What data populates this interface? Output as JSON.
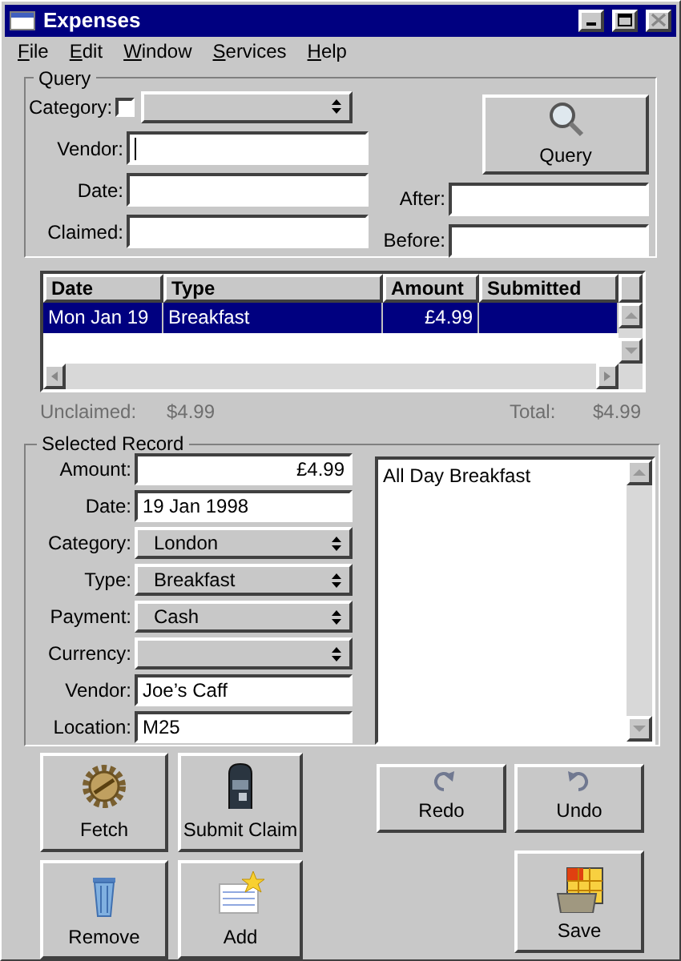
{
  "window": {
    "title": "Expenses"
  },
  "menu": [
    {
      "label": "File"
    },
    {
      "label": "Edit"
    },
    {
      "label": "Window"
    },
    {
      "label": "Services"
    },
    {
      "label": "Help"
    }
  ],
  "query": {
    "title": "Query",
    "category": {
      "label": "Category:",
      "checked": false
    },
    "fields": [
      {
        "label": "Vendor:",
        "focused": true
      },
      {
        "label": "Date:",
        "focused": false
      },
      {
        "label": "Claimed:",
        "focused": false
      }
    ],
    "range": [
      {
        "label": "After:"
      },
      {
        "label": "Before:"
      }
    ],
    "button": "Query"
  },
  "table": {
    "columns": [
      "Date",
      "Type",
      "Amount",
      "Submitted"
    ],
    "rows": [
      {
        "cells": [
          "Mon Jan 19",
          "Breakfast",
          "£4.99",
          ""
        ],
        "selected": true
      }
    ]
  },
  "totals": [
    {
      "label": "Unclaimed:",
      "value": "$4.99"
    },
    {
      "label": "Total:",
      "value": "$4.99"
    }
  ],
  "record": {
    "title": "Selected Record",
    "fields": [
      {
        "kind": "number",
        "label": "Amount:",
        "value": "£4.99"
      },
      {
        "kind": "text",
        "label": "Date:",
        "value": "19 Jan 1998"
      },
      {
        "kind": "select",
        "label": "Category:",
        "value": "London"
      },
      {
        "kind": "select",
        "label": "Type:",
        "value": "Breakfast"
      },
      {
        "kind": "select",
        "label": "Payment:",
        "value": "Cash"
      },
      {
        "kind": "select",
        "label": "Currency:"
      },
      {
        "kind": "text",
        "label": "Vendor:",
        "value": "Joe’s Caff"
      },
      {
        "kind": "text",
        "label": "Location:",
        "value": "M25"
      }
    ],
    "notes": "All Day Breakfast"
  },
  "buttons": [
    {
      "kind": "fetch",
      "label": "Fetch"
    },
    {
      "kind": "submit",
      "label": "Submit Claim"
    },
    {
      "kind": "redo",
      "label": "Redo"
    },
    {
      "kind": "undo",
      "label": "Undo"
    },
    {
      "kind": "remove",
      "label": "Remove"
    },
    {
      "kind": "add",
      "label": "Add"
    },
    {
      "kind": "save",
      "label": "Save"
    }
  ]
}
